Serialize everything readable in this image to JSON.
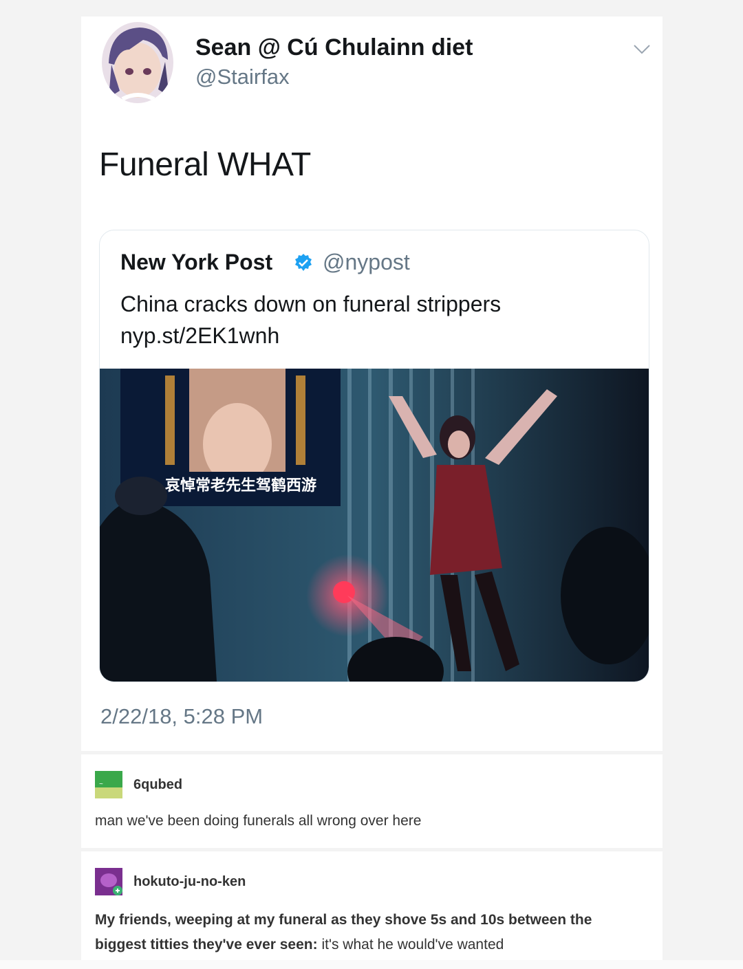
{
  "tweet": {
    "author_name": "Sean @ Cú Chulainn diet",
    "author_handle": "@Stairfax",
    "text": "Funeral WHAT",
    "timestamp": "2/22/18, 5:28 PM",
    "icons": {
      "menu": "chevron-down-icon",
      "avatar": "anime-avatar"
    }
  },
  "quoted_tweet": {
    "author_name": "New York Post",
    "verified_icon": "verified-badge-icon",
    "author_handle": "@nypost",
    "text": "China cracks down on funeral strippers",
    "link": "nyp.st/2EK1wnh",
    "media_icon": "funeral-stage-photo",
    "media_caption_chars": "哀悼常老先生驾鹤西游"
  },
  "comments": [
    {
      "username": "6qubed",
      "body": "man we've been doing funerals all wrong over here",
      "avatar_color": "#3aa84a"
    },
    {
      "username": "hokuto-ju-no-ken",
      "body_bold": "My friends, weeping at my funeral as they shove 5s and 10s between the biggest titties they've ever seen:",
      "body_rest": " it's what he would've wanted",
      "avatar_color": "#7a2f8f"
    }
  ],
  "colors": {
    "twitter_blue": "#1da1f2",
    "text_dark": "#14171a",
    "text_gray": "#657786"
  }
}
